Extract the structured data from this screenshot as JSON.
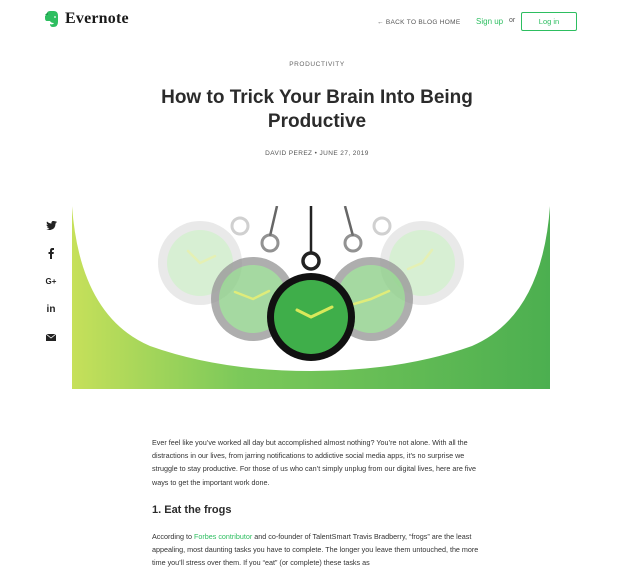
{
  "header": {
    "brand": "Evernote",
    "back_link": "← BACK TO BLOG HOME",
    "signup": "Sign up",
    "or": "or",
    "login": "Log in"
  },
  "article": {
    "category": "PRODUCTIVITY",
    "title": "How to Trick Your Brain Into Being Productive",
    "byline": "DAVID PEREZ • JUNE 27, 2019",
    "intro": "Ever feel like you’ve worked all day but accomplished almost nothing? You’re not alone. With all the distractions in our lives, from jarring notifications to addictive social media apps, it’s no surprise we struggle to stay productive. For those of us who can’t simply unplug from our digital lives, here are five ways to get the important work done.",
    "heading_1": "1. Eat the frogs",
    "para_1_before": "According to ",
    "para_1_link": "Forbes contributor",
    "para_1_after": " and co-founder of TalentSmart Travis Bradberry, “frogs” are the least appealing, most daunting tasks you have to complete. The longer you leave them untouched, the more time you’ll stress over them. If you “eat” (or complete) these tasks as"
  },
  "share": [
    {
      "icon": "twitter-icon",
      "glyph": "❛"
    },
    {
      "icon": "facebook-icon",
      "glyph": "f"
    },
    {
      "icon": "google-plus-icon",
      "glyph": "G+"
    },
    {
      "icon": "linkedin-icon",
      "glyph": "in"
    },
    {
      "icon": "email-icon",
      "glyph": "✉"
    }
  ],
  "colors": {
    "accent": "#2dbe60",
    "hero_green": "#4caf50",
    "hero_lime": "#c6e05a"
  }
}
